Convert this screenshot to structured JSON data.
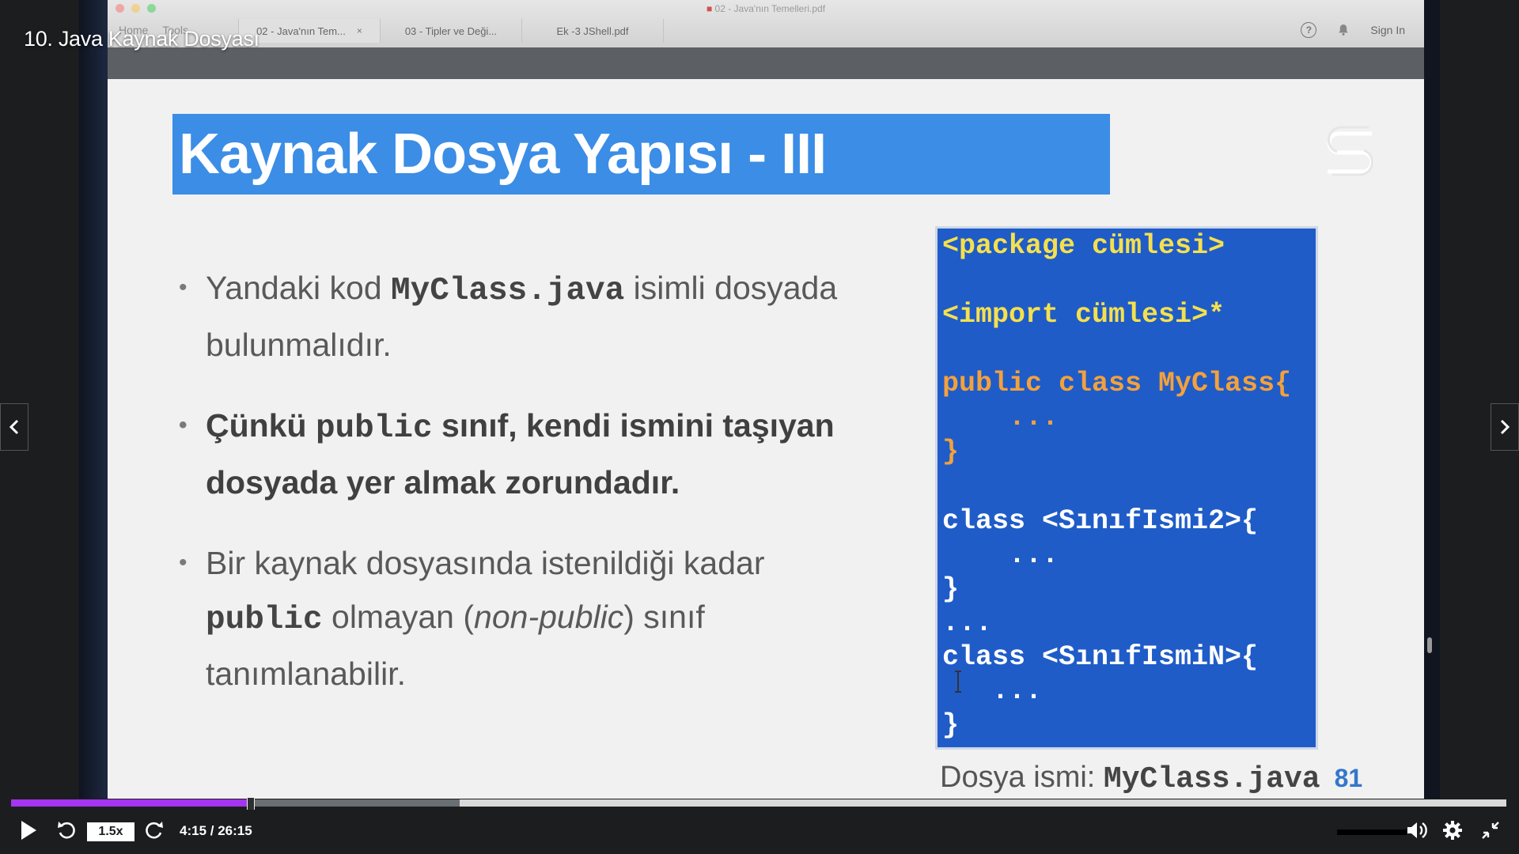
{
  "player": {
    "course_title": "10. Java Kaynak Dosyası",
    "speed": "1.5x",
    "time_display": "4:15 / 26:15",
    "progress_played": 0.16,
    "progress_buffered": 0.3,
    "accent_color": "#a435f0"
  },
  "viewer": {
    "document_title": "02 - Java'nın Temelleri.pdf",
    "nav": [
      "Home",
      "Tools"
    ],
    "tabs": [
      {
        "label": "02 - Java'nın Tem...",
        "close": "×"
      },
      {
        "label": "03 - Tipler ve Deği..."
      },
      {
        "label": "Ek -3 JShell.pdf"
      }
    ],
    "help_icon": "?",
    "sign_in": "Sign In"
  },
  "slide": {
    "title": "Kaynak Dosya Yapısı - III",
    "title_bg": "#3b8de6",
    "bullets": {
      "b1_pre": "Yandaki kod ",
      "b1_code": "MyClass.java",
      "b1_post": " isimli dosyada bulunmalıdır.",
      "b2_pre": "Çünkü ",
      "b2_code": "public",
      "b2_post": " sınıf, kendi ismini taşıyan dosyada yer almak zorundadır.",
      "b3_pre": "Bir kaynak dosyasında istenildiği kadar ",
      "b3_code": "public",
      "b3_mid": " olmayan (",
      "b3_ital": "non-public",
      "b3_post": ") sınıf tanımlanabilir."
    },
    "code_lines": [
      "<package cümlesi>",
      "<import cümlesi>*",
      "public class MyClass{",
      "    ...",
      "}",
      "class <SınıfIsmi2>{",
      "    ...",
      "}",
      "...",
      "class <SınıfIsmiN>{",
      "   ...",
      "}"
    ],
    "file_label": "Dosya ismi: ",
    "file_name": "MyClass.java",
    "page_number": "81"
  }
}
